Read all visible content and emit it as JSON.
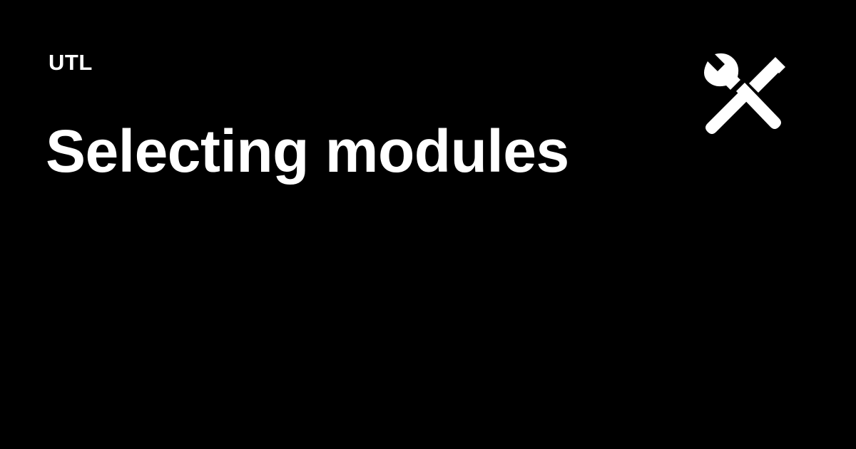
{
  "site": {
    "name": "UTL"
  },
  "page": {
    "title": "Selecting modules"
  },
  "icons": {
    "tools": "wrench-and-screwdriver-icon"
  },
  "colors": {
    "background": "#000000",
    "text": "#ffffff",
    "icon": "#ffffff"
  }
}
